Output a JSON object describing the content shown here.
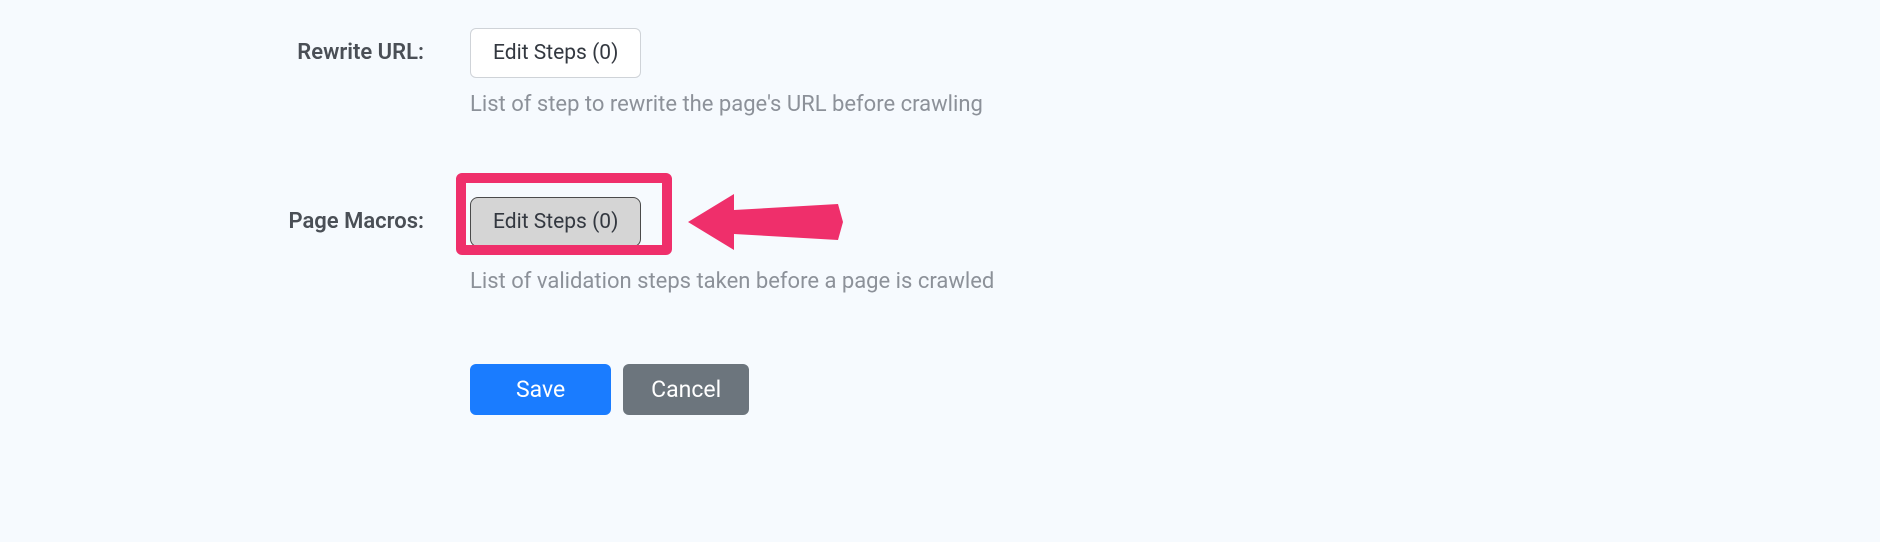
{
  "fields": {
    "rewrite_url": {
      "label": "Rewrite URL:",
      "button_label": "Edit Steps (0)",
      "help": "List of step to rewrite the page's URL before crawling"
    },
    "page_macros": {
      "label": "Page Macros:",
      "button_label": "Edit Steps (0)",
      "help": "List of validation steps taken before a page is crawled"
    }
  },
  "actions": {
    "save_label": "Save",
    "cancel_label": "Cancel"
  },
  "annotation": {
    "highlight_color": "#ef2f6b"
  }
}
